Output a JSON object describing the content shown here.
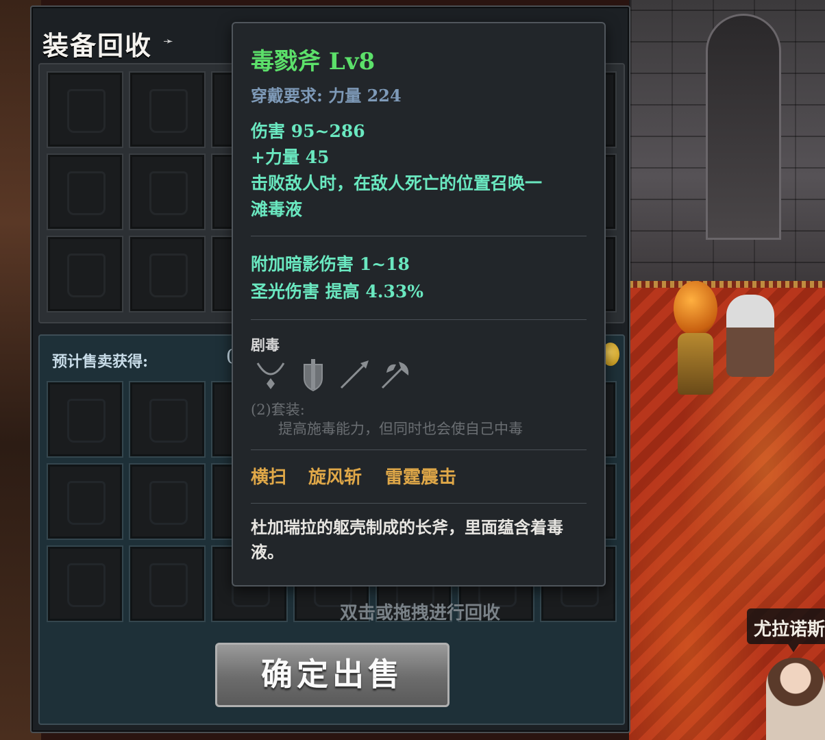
{
  "panel": {
    "title": "装备回收",
    "estimate_label": "预计售卖获得:",
    "estimate_value": "0",
    "hint": "双击或拖拽进行回收",
    "sell_button": "确定出售"
  },
  "tooltip": {
    "name": "毒戮斧  Lv8",
    "requirement": "穿戴要求:   力量  224",
    "stats": [
      "伤害   95~286",
      "+力量  45",
      "击败敌人时，在敌人死亡的位置召唤一",
      "滩毒液"
    ],
    "extra_stats": [
      "附加暗影伤害  1~18",
      "圣光伤害  提高  4.33%"
    ],
    "set_name": "剧毒",
    "set_icons": [
      "necklace-icon",
      "shield-icon",
      "spear-icon",
      "axe-icon"
    ],
    "set_bonus_title": "(2)套装:",
    "set_bonus_desc": "提高施毒能力，但同时也会使自己中毒",
    "skills": [
      "横扫",
      "旋风斩",
      "雷霆震击"
    ],
    "flavor": "杜加瑞拉的躯壳制成的长斧，里面蕴含着毒液。"
  },
  "npc": {
    "name": "尤拉诺斯"
  },
  "colors": {
    "item_name": "#5ce06a",
    "stat": "#6ae8c0",
    "requirement": "#7e9ab8",
    "skill": "#e0a848"
  }
}
